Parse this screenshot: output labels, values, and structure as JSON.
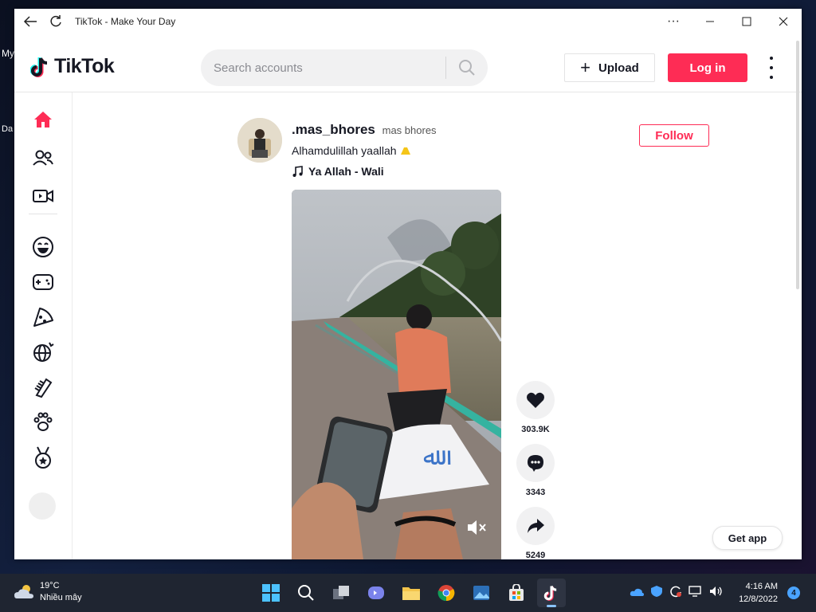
{
  "desktop": {
    "label_top": "My",
    "label_bottom": "Da"
  },
  "window": {
    "title": "TikTok - Make Your Day"
  },
  "header": {
    "logo_text": "TikTok",
    "search_placeholder": "Search accounts",
    "upload_label": "Upload",
    "login_label": "Log in"
  },
  "sidebar": {
    "icons": [
      "home-icon",
      "following-icon",
      "live-icon",
      "comedy-icon",
      "gaming-icon",
      "food-icon",
      "travel-icon",
      "beauty-icon",
      "animals-icon",
      "sports-icon"
    ]
  },
  "post": {
    "username": ".mas_bhores",
    "nickname": "mas bhores",
    "caption": "Alhamdulillah yaallah",
    "music": "Ya Allah - Wali",
    "follow_label": "Follow",
    "likes": "303.9K",
    "comments": "3343",
    "shares": "5249"
  },
  "get_app_label": "Get app",
  "taskbar": {
    "temperature": "19°C",
    "weather_desc": "Nhiều mây",
    "time": "4:16 AM",
    "date": "12/8/2022",
    "notifications": "4"
  },
  "colors": {
    "brand": "#fe2c55",
    "taskbar": "#1f2531"
  }
}
